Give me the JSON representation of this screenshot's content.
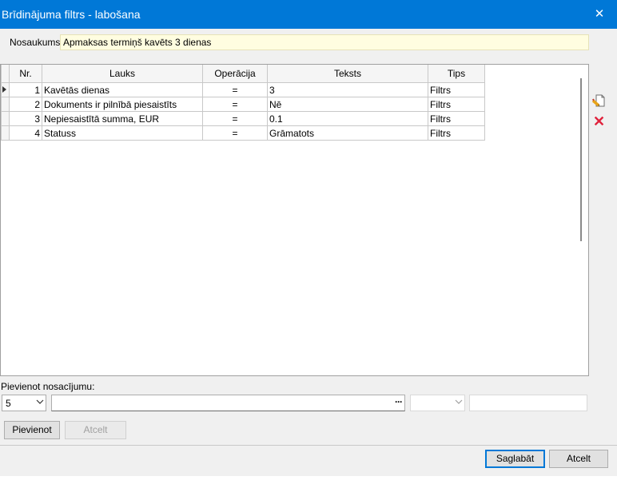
{
  "window": {
    "title": "Brīdinājuma filtrs - labošana",
    "close_glyph": "✕"
  },
  "name_field": {
    "label": "Nosaukums:",
    "value": "Apmaksas termiņš kavēts 3 dienas"
  },
  "grid": {
    "columns": [
      "Nr.",
      "Lauks",
      "Operācija",
      "Teksts",
      "Tips"
    ],
    "current_row": 1,
    "rows": [
      {
        "nr": "1",
        "lauks": "Kavētās dienas",
        "operacija": "=",
        "teksts": "3",
        "tips": "Filtrs"
      },
      {
        "nr": "2",
        "lauks": "Dokuments ir pilnībā piesaistīts",
        "operacija": "=",
        "teksts": "Nē",
        "tips": "Filtrs"
      },
      {
        "nr": "3",
        "lauks": "Nepiesaistītā summa, EUR",
        "operacija": "=",
        "teksts": "0.1",
        "tips": "Filtrs"
      },
      {
        "nr": "4",
        "lauks": "Statuss",
        "operacija": "=",
        "teksts": "Grāmatots",
        "tips": "Filtrs"
      }
    ]
  },
  "side_toolbar": {
    "edit_icon": "edit-icon",
    "delete_icon": "delete-icon",
    "delete_glyph": "✕",
    "delete_color": "#e0223c"
  },
  "add_condition": {
    "label": "Pievienot nosacījumu:",
    "number_value": "5",
    "field_value": "",
    "browse_glyph": "···",
    "operation_value": "",
    "text_value": "",
    "add_button": "Pievienot",
    "cancel_button": "Atcelt"
  },
  "footer": {
    "save_button": "Saglabāt",
    "cancel_button": "Atcelt"
  },
  "colors": {
    "titlebar": "#0078d7",
    "name_field_bg": "#fffde0",
    "dialog_bg": "#f0f0f0"
  }
}
